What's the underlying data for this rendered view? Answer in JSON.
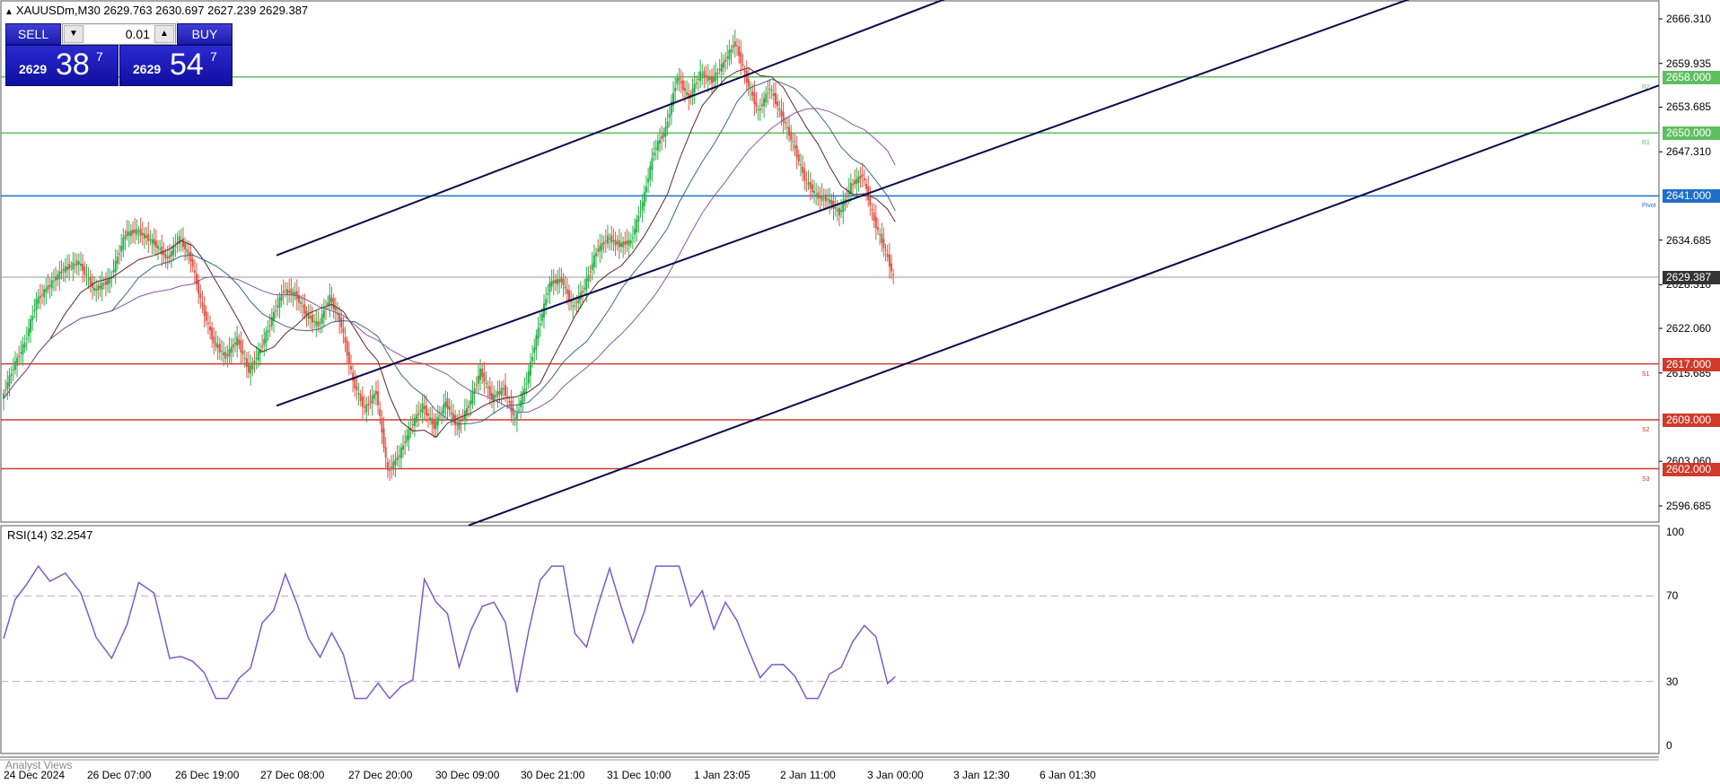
{
  "symbol_title": "XAUUSDm,M30  2629.763 2630.697 2627.239 2629.387",
  "trade_panel": {
    "sell_label": "SELL",
    "buy_label": "BUY",
    "lot": "0.01",
    "sell_price_big": "2629",
    "sell_price_main": "38",
    "sell_price_sup": "7",
    "buy_price_big": "2629",
    "buy_price_main": "54",
    "buy_price_sup": "7"
  },
  "price_axis": [
    "2666.310",
    "2659.935",
    "2653.685",
    "2647.310",
    "2634.685",
    "2628.310",
    "2622.060",
    "2615.685",
    "2603.060",
    "2596.685"
  ],
  "price_scale": {
    "top_price": 2666.31,
    "bottom_price": 2596.685
  },
  "current_price": {
    "value": 2629.387,
    "label": "2629.387",
    "color": "#333333"
  },
  "levels": [
    {
      "key": "r2",
      "price": 2658.0,
      "label": "2658.000",
      "color": "#5fbf5f",
      "note": "R2"
    },
    {
      "key": "r1",
      "price": 2650.0,
      "label": "2650.000",
      "color": "#5fbf5f",
      "note": "R1"
    },
    {
      "key": "pivot",
      "price": 2641.0,
      "label": "2641.000",
      "color": "#1f6fc8",
      "note": "Pivot"
    },
    {
      "key": "s1",
      "price": 2617.0,
      "label": "2617.000",
      "color": "#d03a2a",
      "note": "S1"
    },
    {
      "key": "s2",
      "price": 2609.0,
      "label": "2609.000",
      "color": "#d03a2a",
      "note": "S2"
    },
    {
      "key": "s3",
      "price": 2602.0,
      "label": "2602.000",
      "color": "#d03a2a",
      "note": "S3"
    }
  ],
  "rsi": {
    "label": "RSI(14) 32.2547",
    "axis": [
      "100",
      "70",
      "30",
      "0"
    ],
    "level_high": 70,
    "level_low": 30,
    "value": 32.2547,
    "line_color": "#7a5cc8"
  },
  "time_axis": [
    "24 Dec 2024",
    "26 Dec 07:00",
    "26 Dec 19:00",
    "27 Dec 08:00",
    "27 Dec 20:00",
    "30 Dec 09:00",
    "30 Dec 21:00",
    "31 Dec 10:00",
    "1 Jan 23:05",
    "2 Jan 11:00",
    "3 Jan 00:00",
    "3 Jan 12:30",
    "6 Jan 01:30"
  ],
  "analyst_views_label": "Analyst Views",
  "colors": {
    "bull_candle": "#2bb24c",
    "bear_candle": "#e0554a",
    "channel": "#0b0b4a",
    "ma_fast": "#5a2a2a",
    "ma_mid": "#3a6a7a",
    "ma_slow": "#8a5a9a"
  },
  "chart_data": {
    "type": "candlestick",
    "series_name": "XAUUSDm, M30",
    "ylim": [
      2596.685,
      2666.31
    ],
    "ohlc_close_path": [
      [
        0,
        2612.0
      ],
      [
        6,
        2616.5
      ],
      [
        12,
        2620.0
      ],
      [
        18,
        2626.0
      ],
      [
        24,
        2628.0
      ],
      [
        32,
        2630.5
      ],
      [
        40,
        2631.5
      ],
      [
        48,
        2627.5
      ],
      [
        56,
        2629.0
      ],
      [
        64,
        2635.5
      ],
      [
        70,
        2636.0
      ],
      [
        78,
        2634.5
      ],
      [
        86,
        2632.0
      ],
      [
        92,
        2635.0
      ],
      [
        98,
        2632.0
      ],
      [
        104,
        2625.0
      ],
      [
        110,
        2620.0
      ],
      [
        116,
        2618.0
      ],
      [
        122,
        2620.5
      ],
      [
        128,
        2616.0
      ],
      [
        134,
        2619.0
      ],
      [
        140,
        2623.5
      ],
      [
        146,
        2627.5
      ],
      [
        152,
        2627.0
      ],
      [
        158,
        2624.0
      ],
      [
        164,
        2622.5
      ],
      [
        170,
        2626.5
      ],
      [
        176,
        2622.5
      ],
      [
        182,
        2614.5
      ],
      [
        188,
        2610.5
      ],
      [
        194,
        2613.0
      ],
      [
        200,
        2601.5
      ],
      [
        206,
        2604.0
      ],
      [
        212,
        2608.0
      ],
      [
        218,
        2611.0
      ],
      [
        224,
        2608.0
      ],
      [
        230,
        2611.5
      ],
      [
        236,
        2608.0
      ],
      [
        242,
        2611.0
      ],
      [
        248,
        2616.0
      ],
      [
        254,
        2612.0
      ],
      [
        260,
        2613.5
      ],
      [
        266,
        2609.0
      ],
      [
        272,
        2614.5
      ],
      [
        278,
        2622.0
      ],
      [
        284,
        2628.5
      ],
      [
        290,
        2629.0
      ],
      [
        296,
        2625.0
      ],
      [
        302,
        2628.0
      ],
      [
        308,
        2633.0
      ],
      [
        314,
        2635.0
      ],
      [
        320,
        2634.0
      ],
      [
        326,
        2634.5
      ],
      [
        332,
        2640.0
      ],
      [
        338,
        2647.5
      ],
      [
        344,
        2650.5
      ],
      [
        350,
        2658.0
      ],
      [
        356,
        2655.0
      ],
      [
        362,
        2658.5
      ],
      [
        368,
        2657.5
      ],
      [
        374,
        2660.0
      ],
      [
        380,
        2663.0
      ],
      [
        386,
        2657.5
      ],
      [
        392,
        2653.0
      ],
      [
        398,
        2656.5
      ],
      [
        404,
        2652.5
      ],
      [
        410,
        2648.5
      ],
      [
        416,
        2643.5
      ],
      [
        422,
        2641.0
      ],
      [
        428,
        2640.5
      ],
      [
        434,
        2638.5
      ],
      [
        440,
        2642.5
      ],
      [
        446,
        2644.0
      ],
      [
        452,
        2637.5
      ],
      [
        458,
        2633.0
      ],
      [
        462,
        2629.4
      ]
    ]
  }
}
